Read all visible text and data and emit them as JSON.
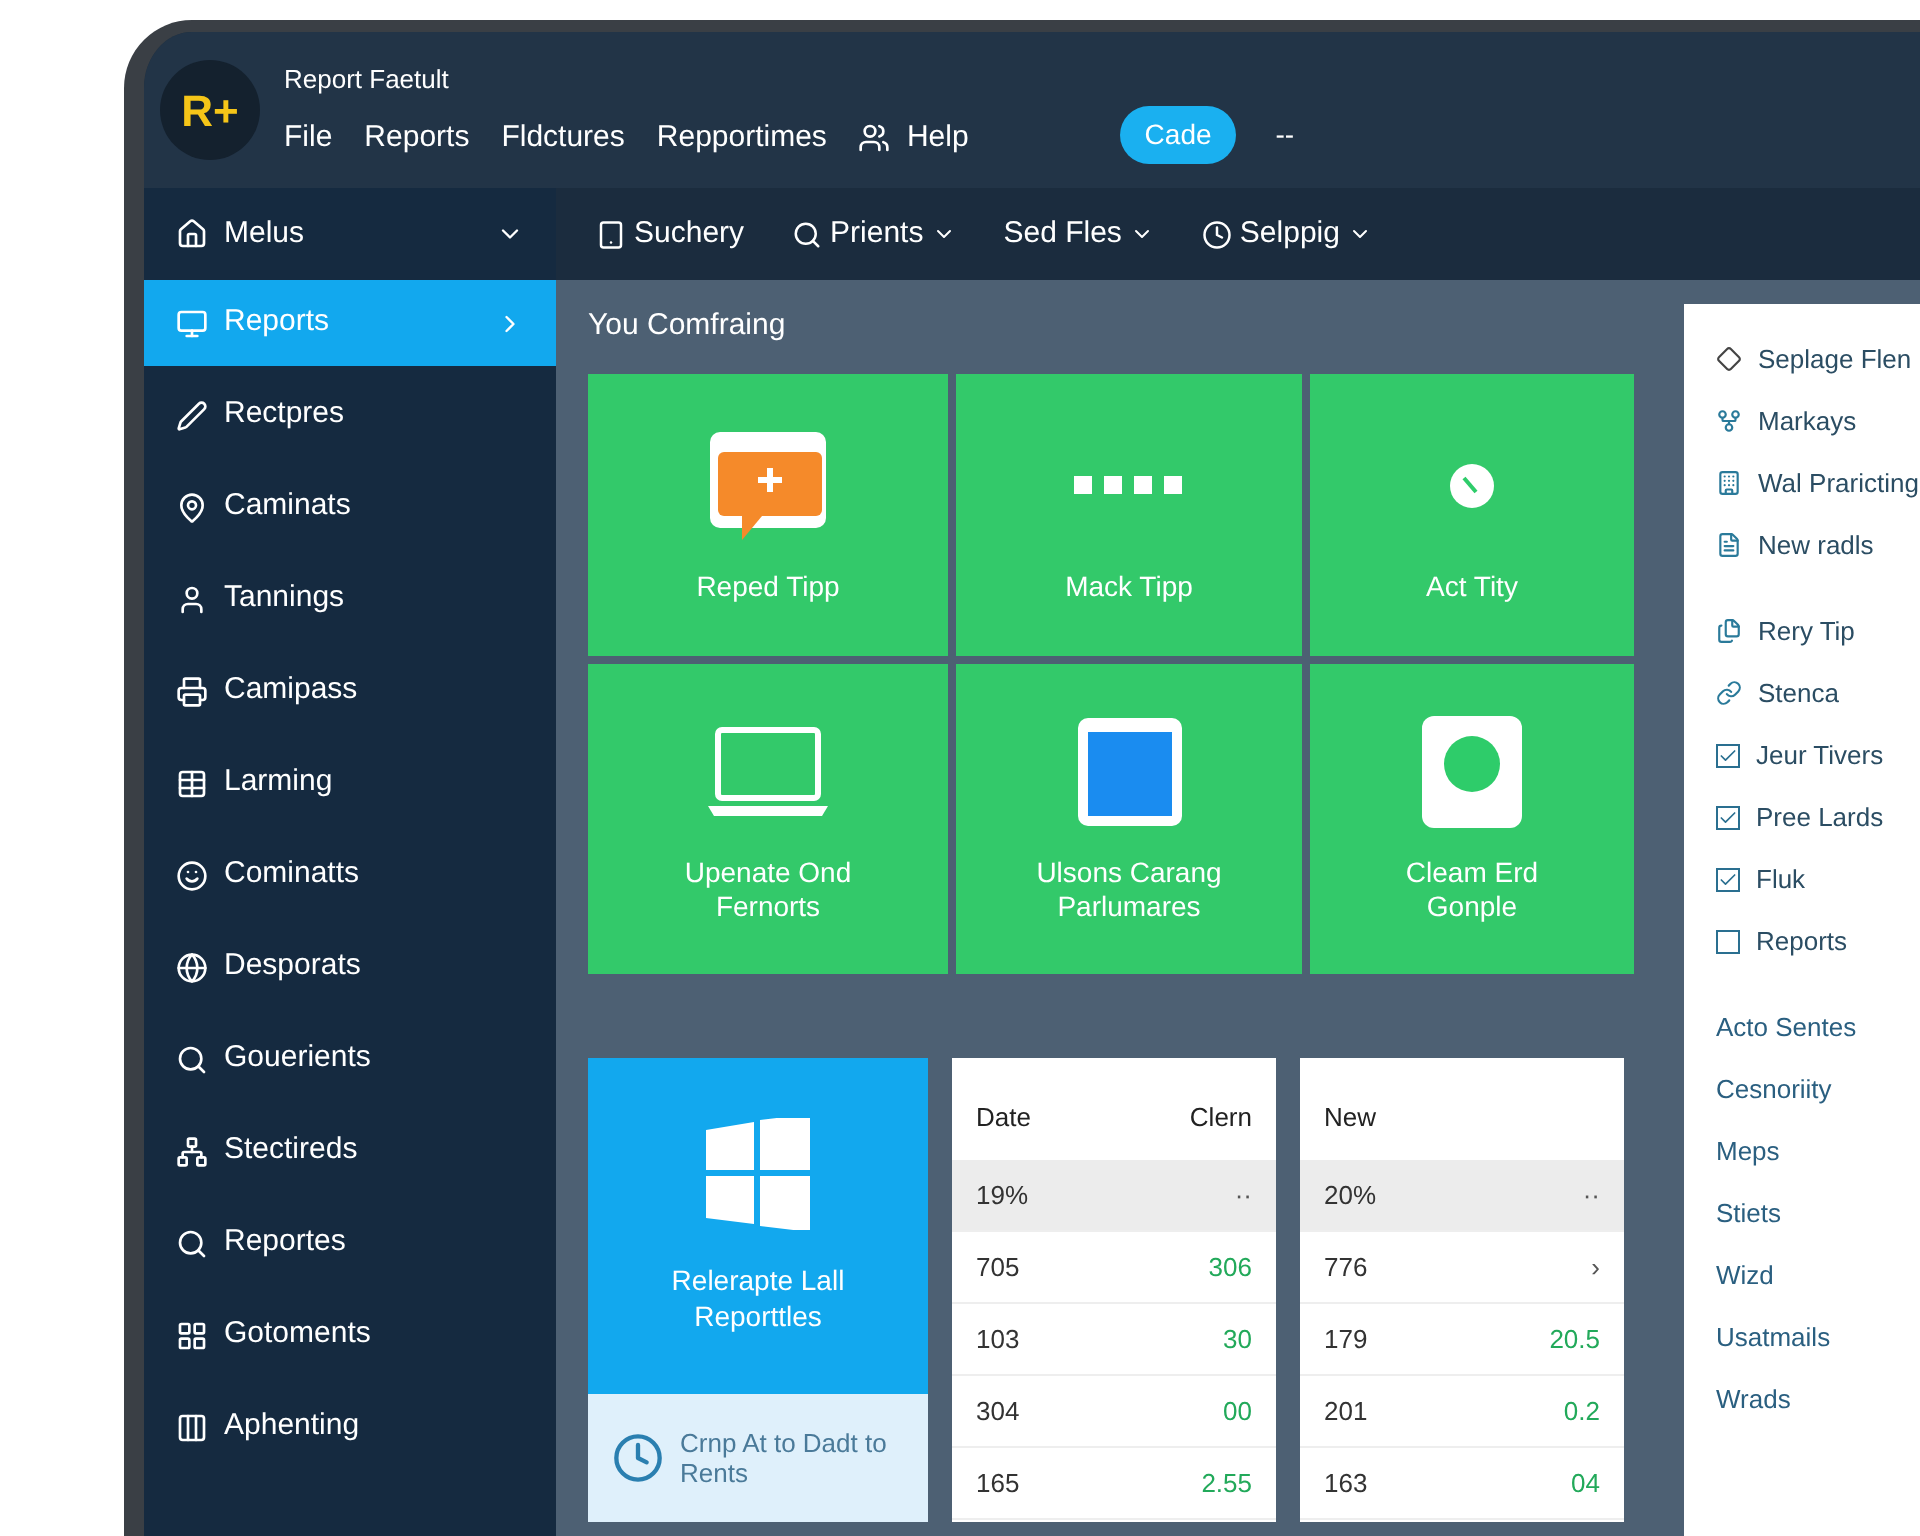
{
  "app": {
    "logo": "R+",
    "title": "Report Faetult"
  },
  "menu": [
    {
      "label": "File"
    },
    {
      "label": "Reports"
    },
    {
      "label": "Fldctures"
    },
    {
      "label": "Repportimes"
    },
    {
      "label": "Help",
      "kind": "icon"
    }
  ],
  "header_button": "Cade",
  "header_extra": "--",
  "sidebar": {
    "header": "Melus",
    "items": [
      {
        "label": "Reports",
        "selected": true
      },
      {
        "label": "Rectpres",
        "selected": false
      },
      {
        "label": "Caminats",
        "selected": false
      },
      {
        "label": "Tannings",
        "selected": false
      },
      {
        "label": "Camipass",
        "selected": false
      },
      {
        "label": "Larming",
        "selected": false
      },
      {
        "label": "Cominatts",
        "selected": false
      },
      {
        "label": "Desporats",
        "selected": false
      },
      {
        "label": "Gouerients",
        "selected": false
      },
      {
        "label": "Stectireds",
        "selected": false
      },
      {
        "label": "Reportes",
        "selected": false
      },
      {
        "label": "Gotoments",
        "selected": false
      },
      {
        "label": "Aphenting",
        "selected": false
      }
    ]
  },
  "toolbar": [
    {
      "label": "Suchery",
      "dropdown": false
    },
    {
      "label": "Prients",
      "dropdown": true
    },
    {
      "label": "Sed Fles",
      "dropdown": true
    },
    {
      "label": "Selppig",
      "dropdown": true
    }
  ],
  "section_title": "You Comfraing",
  "tiles": [
    {
      "label": "Reped Tipp"
    },
    {
      "label": "Mack Tipp"
    },
    {
      "label": "Act Tity"
    },
    {
      "label": "Upenate Ond Fernorts"
    },
    {
      "label": "Ulsons Carang Parlumares"
    },
    {
      "label": "Cleam Erd Gonple"
    }
  ],
  "promo": {
    "title": "Relerapte Lall Reporttles",
    "footer": "Crnp At to Dadt to Rents"
  },
  "tables": [
    {
      "columns": [
        "Date",
        "Clern"
      ],
      "rows": [
        {
          "cells": [
            "19%",
            "··"
          ],
          "selected": true,
          "positive": false
        },
        {
          "cells": [
            "705",
            "306"
          ],
          "selected": false,
          "positive": true
        },
        {
          "cells": [
            "103",
            "30"
          ],
          "selected": false,
          "positive": true
        },
        {
          "cells": [
            "304",
            "00"
          ],
          "selected": false,
          "positive": true
        },
        {
          "cells": [
            "165",
            "2.55"
          ],
          "selected": false,
          "positive": true
        }
      ]
    },
    {
      "columns": [
        "New"
      ],
      "rows": [
        {
          "cells": [
            "20%",
            "··"
          ],
          "selected": true,
          "positive": false
        },
        {
          "cells": [
            "776",
            "›"
          ],
          "selected": false,
          "positive": false
        },
        {
          "cells": [
            "179",
            "20.5"
          ],
          "selected": false,
          "positive": true
        },
        {
          "cells": [
            "201",
            "0.2"
          ],
          "selected": false,
          "positive": true
        },
        {
          "cells": [
            "163",
            "04"
          ],
          "selected": false,
          "positive": true
        }
      ]
    }
  ],
  "side_panel": [
    {
      "kind": "icon",
      "label": "Seplage Flen"
    },
    {
      "kind": "icon",
      "label": "Markays"
    },
    {
      "kind": "icon",
      "label": "Wal Praricting"
    },
    {
      "kind": "icon",
      "label": "New radls"
    },
    {
      "kind": "icon",
      "label": "Rery Tip"
    },
    {
      "kind": "icon",
      "label": "Stenca"
    },
    {
      "kind": "checkbox",
      "label": "Jeur Tivers",
      "checked": true
    },
    {
      "kind": "checkbox",
      "label": "Pree Lards",
      "checked": true
    },
    {
      "kind": "checkbox",
      "label": "Fluk",
      "checked": true
    },
    {
      "kind": "checkbox",
      "label": "Reports",
      "checked": false
    },
    {
      "kind": "link",
      "label": "Acto Sentes"
    },
    {
      "kind": "link",
      "label": "Cesnoriity"
    },
    {
      "kind": "link",
      "label": "Meps"
    },
    {
      "kind": "link",
      "label": "Stiets"
    },
    {
      "kind": "link",
      "label": "Wizd"
    },
    {
      "kind": "link",
      "label": "Usatmails"
    },
    {
      "kind": "link",
      "label": "Wrads"
    }
  ]
}
